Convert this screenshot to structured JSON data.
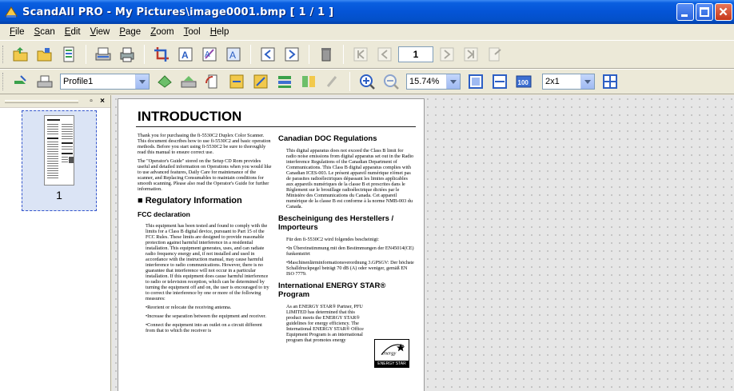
{
  "window": {
    "title": "ScandAll PRO - My Pictures\\image0001.bmp  [ 1 / 1 ]"
  },
  "menu": [
    "File",
    "Scan",
    "Edit",
    "View",
    "Page",
    "Zoom",
    "Tool",
    "Help"
  ],
  "toolbar1": {
    "page_number": "1"
  },
  "toolbar2": {
    "profile": "Profile1",
    "zoom": "15.74%",
    "layout": "2x1"
  },
  "left_pane": {
    "thumbnail_label": "1"
  },
  "document": {
    "heading": "INTRODUCTION",
    "intro1": "Thank you for purchasing the fi-5530C2 Duplex Color Scanner. This document describes how to use fi-5530C2 and basic operation methods. Before you start using fi-5530C2 be sure to thoroughly read this manual to ensure correct use.",
    "intro2": "The \"Operator's Guide\" stored on the Setup CD Rom provides useful and detailed information on Operations when you would like to use advanced features, Daily Care for maintenance of the scanner, and Replacing Consumables to maintain conditions for smooth scanning. Please also read the Operator's Guide for further information.",
    "regulatory": "■ Regulatory Information",
    "fcc_heading": "FCC declaration",
    "fcc_text": "This equipment has been tested and found to comply with the limits for a Class B digital device, pursuant to Part 15 of the FCC Rules. These limits are designed to provide reasonable protection against harmful interference in a residential installation. This equipment generates, uses, and can radiate radio frequency energy and, if not installed and used in accordance with the instruction manual, may cause harmful interference to radio communications. However, there is no guarantee that interference will not occur in a particular installation. If this equipment does cause harmful interference to radio or television reception, which can be determined by turning the equipment off and on, the user is encouraged to try to correct the interference by one or more of the following measures:",
    "fcc_b1": "•Reorient or relocate the receiving antenna.",
    "fcc_b2": "•Increase the separation between the equipment and receiver.",
    "fcc_b3": "•Connect the equipment into an outlet on a circuit different from that to which the receiver is",
    "canada_heading": "Canadian DOC Regulations",
    "canada_text": "This digital apparatus does not exceed the Class B limit for radio noise emissions from digital apparatus set out in the Radio interference Regulations of the Canadian Department of Communications. This Class B digital apparatus complies with Canadian ICES-003. Le présent appareil numérique n'émet pas de parasites radioélectriques dépassant les limites applicables aux appareils numériques de la classe B et prescrites dans le Règlement sur le brouillage radioélectrique dictées par le Ministère des Communications du Canada. Cet appareil numérique de la classe B est conforme à la norme NMB-003 du Canada.",
    "german_heading": "Bescheinigung des Herstellers / Importeurs",
    "german_text": "Für den fi-5530C2 wird folgendes bescheinigt:",
    "german_b1": "•In Übereinstimmung mit den Bestimmungen der EN45014(CE) funkentstört",
    "german_b2": "•Maschinenlärminformationsverordnung 3.GPSGV: Der höchste Schalldruckpegel beträgt 70 dB (A) oder weniger, gemäß EN ISO 7779.",
    "energy_heading": "International ENERGY STAR® Program",
    "energy_text": "As an ENERGY STAR® Partner, PFU LIMITED has determined that this product meets the ENERGY STAR® guidelines for energy efficiency. The International ENERGY STAR® Office Equipment Program is an international program that promotes energy",
    "energy_logo": "ENERGY STAR"
  }
}
